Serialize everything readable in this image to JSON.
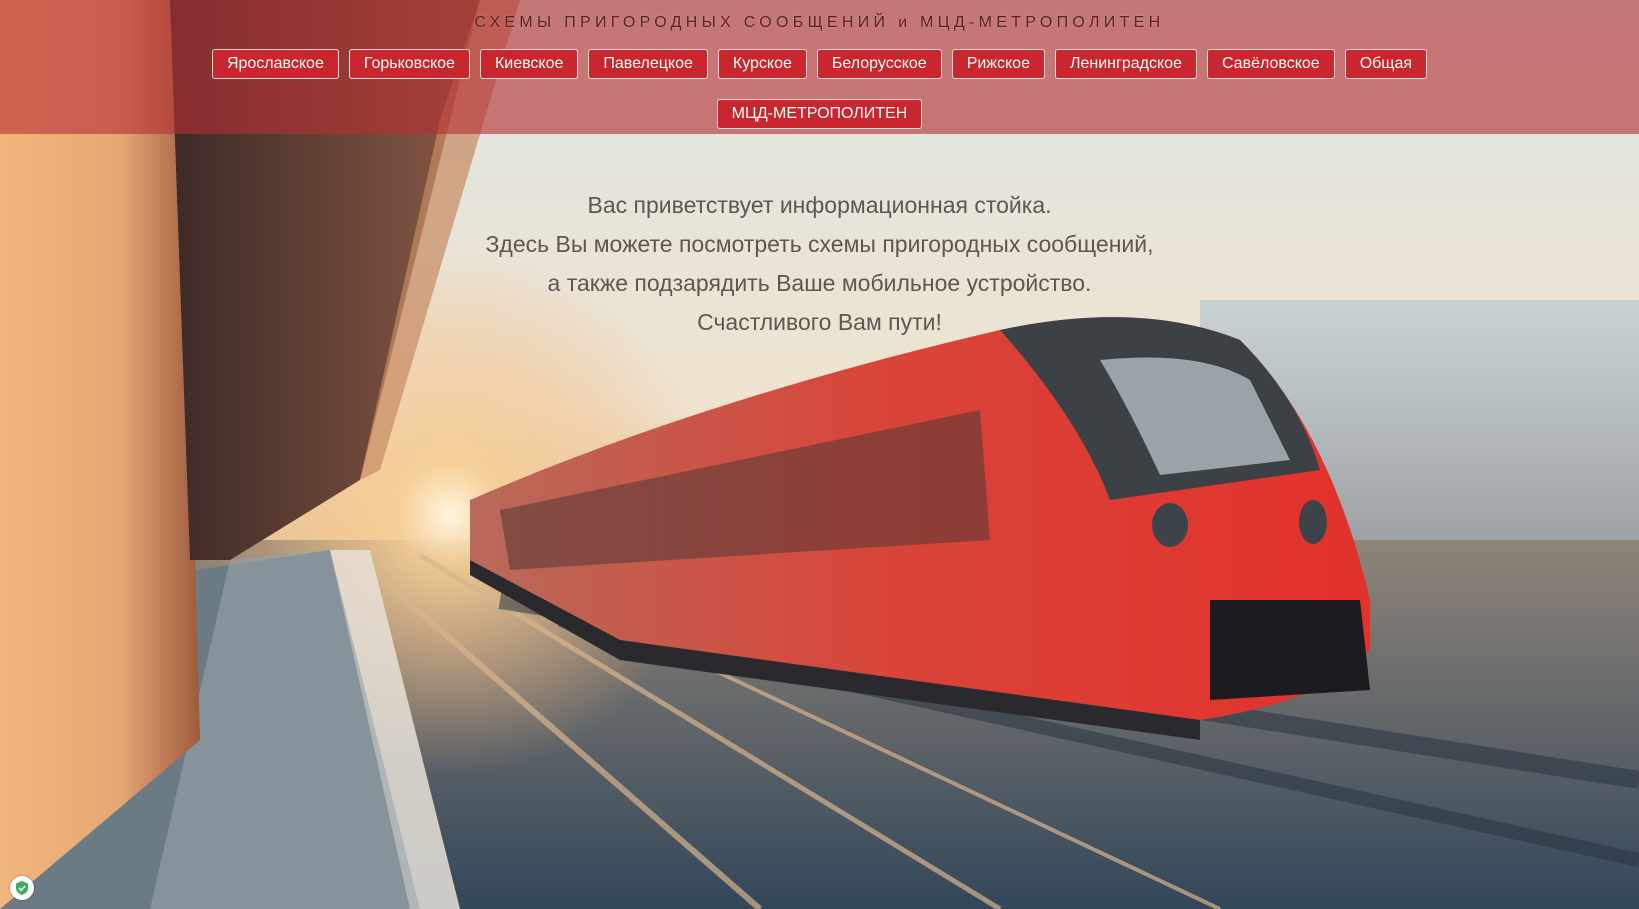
{
  "header": {
    "title": "СХЕМЫ ПРИГОРОДНЫХ СООБЩЕНИЙ и МЦД-МЕТРОПОЛИТЕН"
  },
  "nav": {
    "row1": [
      "Ярославское",
      "Горьковское",
      "Киевское",
      "Павелецкое",
      "Курское",
      "Белорусское",
      "Рижское",
      "Ленинградское",
      "Савёловское",
      "Общая"
    ],
    "row2": [
      "МЦД-МЕТРОПОЛИТЕН"
    ]
  },
  "welcome": {
    "line1": "Вас приветствует информационная стойка.",
    "line2": "Здесь Вы можете посмотреть схемы пригородных сообщений,",
    "line3": "а также подзарядить Ваше мобильное устройство.",
    "line4": "Счастливого Вам пути!"
  },
  "colors": {
    "accent": "#c8272f",
    "header_overlay": "#b43034",
    "button_border": "#f3d6d6",
    "welcome_text": "#5e5650"
  },
  "icons": {
    "badge": "shield-check-icon"
  }
}
